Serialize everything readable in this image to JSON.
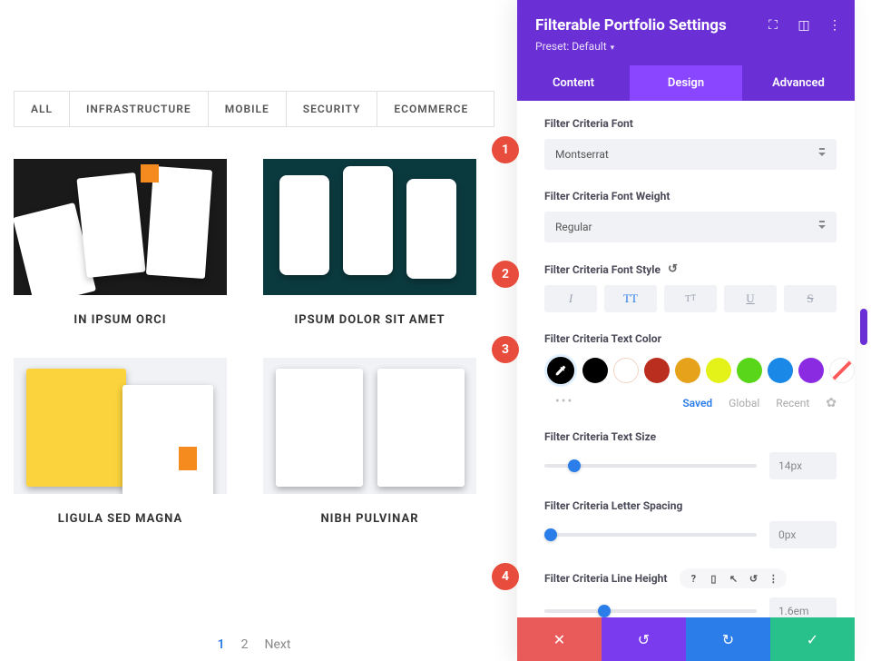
{
  "filters": {
    "items": [
      "ALL",
      "INFRASTRUCTURE",
      "MOBILE",
      "SECURITY",
      "ECOMMERCE"
    ]
  },
  "portfolio": {
    "items": [
      {
        "title": "IN IPSUM ORCI"
      },
      {
        "title": "IPSUM DOLOR SIT AMET"
      },
      {
        "title": "LIGULA SED MAGNA"
      },
      {
        "title": "NIBH PULVINAR"
      }
    ]
  },
  "pagination": {
    "pages": [
      "1",
      "2"
    ],
    "next": "Next",
    "active": 0
  },
  "panel": {
    "title": "Filterable Portfolio Settings",
    "preset": "Preset: Default",
    "tabs": {
      "content": "Content",
      "design": "Design",
      "advanced": "Advanced",
      "active": "design"
    },
    "font": {
      "label": "Filter Criteria Font",
      "value": "Montserrat"
    },
    "weight": {
      "label": "Filter Criteria Font Weight",
      "value": "Regular"
    },
    "style": {
      "label": "Filter Criteria Font Style",
      "active": "TT"
    },
    "textcolor": {
      "label": "Filter Criteria Text Color",
      "swatches": [
        "#000000",
        "#ffffff",
        "#b92e1f",
        "#e6a21a",
        "#e4f21a",
        "#5ad61a",
        "#1a88e6",
        "#8a2be2"
      ],
      "paletteTabs": {
        "saved": "Saved",
        "global": "Global",
        "recent": "Recent"
      }
    },
    "textsize": {
      "label": "Filter Criteria Text Size",
      "value": "14px",
      "pct": 14
    },
    "letterspacing": {
      "label": "Filter Criteria Letter Spacing",
      "value": "0px",
      "pct": 3
    },
    "lineheight": {
      "label": "Filter Criteria Line Height",
      "value": "1.6em",
      "pct": 28
    }
  },
  "badges": {
    "b1": "1",
    "b2": "2",
    "b3": "3",
    "b4": "4"
  }
}
